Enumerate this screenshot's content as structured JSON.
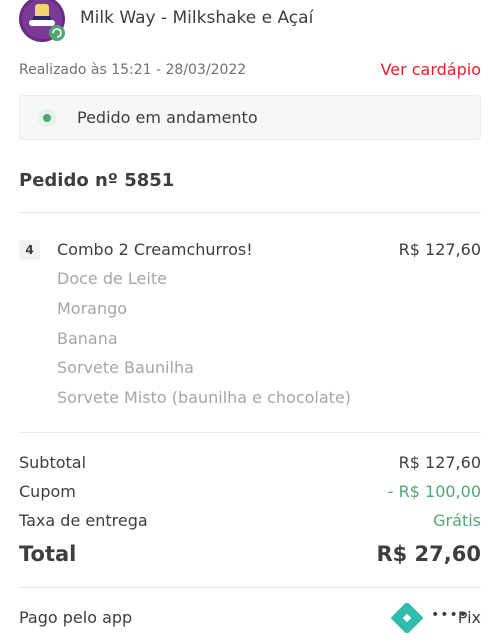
{
  "header": {
    "restaurant_name": "Milk Way - Milkshake e Açaí",
    "order_time": "Realizado às 15:21 - 28/03/2022",
    "menu_link": "Ver cardápio"
  },
  "status": {
    "text": "Pedido em andamento",
    "color": "#50a773"
  },
  "order": {
    "number_label": "Pedido nº 5851",
    "items": [
      {
        "qty": "4",
        "name": "Combo 2 Creamchurros!",
        "price": "R$ 127,60",
        "options": [
          "Doce de Leite",
          "Morango",
          "Banana",
          "Sorvete Baunilha",
          "Sorvete Misto (baunilha e chocolate)"
        ]
      }
    ]
  },
  "summary": {
    "subtotal_label": "Subtotal",
    "subtotal_value": "R$ 127,60",
    "coupon_label": "Cupom",
    "coupon_value": "- R$ 100,00",
    "delivery_label": "Taxa de entrega",
    "delivery_value": "Grátis",
    "total_label": "Total",
    "total_value": "R$ 27,60"
  },
  "payment": {
    "label": "Pago pelo app",
    "masked": "••••",
    "method": "Pix",
    "icon": "pix-icon"
  },
  "colors": {
    "accent": "#ea1d2c",
    "success": "#50a773",
    "pix": "#32bcad"
  }
}
